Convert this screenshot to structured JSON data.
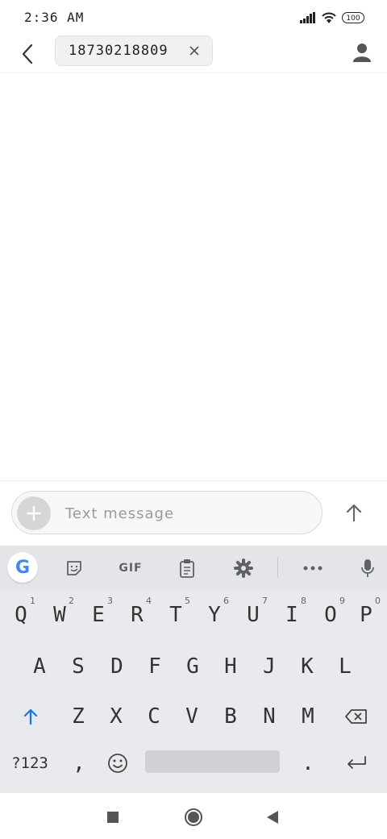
{
  "status_bar": {
    "time": "2:36 AM",
    "battery": "100"
  },
  "header": {
    "recipient": "18730218809"
  },
  "compose": {
    "placeholder": "Text message"
  },
  "keyboard": {
    "toolbar": {
      "gif_label": "GIF",
      "google_letter": "G"
    },
    "row1": [
      {
        "key": "Q",
        "hint": "1"
      },
      {
        "key": "W",
        "hint": "2"
      },
      {
        "key": "E",
        "hint": "3"
      },
      {
        "key": "R",
        "hint": "4"
      },
      {
        "key": "T",
        "hint": "5"
      },
      {
        "key": "Y",
        "hint": "6"
      },
      {
        "key": "U",
        "hint": "7"
      },
      {
        "key": "I",
        "hint": "8"
      },
      {
        "key": "O",
        "hint": "9"
      },
      {
        "key": "P",
        "hint": "0"
      }
    ],
    "row2": [
      "A",
      "S",
      "D",
      "F",
      "G",
      "H",
      "J",
      "K",
      "L"
    ],
    "row3": [
      "Z",
      "X",
      "C",
      "V",
      "B",
      "N",
      "M"
    ],
    "row4": {
      "symbols_label": "?123",
      "comma": ",",
      "period": "."
    }
  },
  "colors": {
    "accent": "#1a73e8",
    "keyboard_bg": "#e8eaed"
  },
  "icons": [
    "back-arrow-icon",
    "close-icon",
    "contact-icon",
    "plus-icon",
    "send-arrow-icon",
    "sticker-icon",
    "clipboard-icon",
    "gear-icon",
    "more-icon",
    "mic-icon",
    "shift-icon",
    "backspace-icon",
    "emoji-icon",
    "enter-icon",
    "recent-apps-icon",
    "home-icon",
    "back-icon"
  ]
}
